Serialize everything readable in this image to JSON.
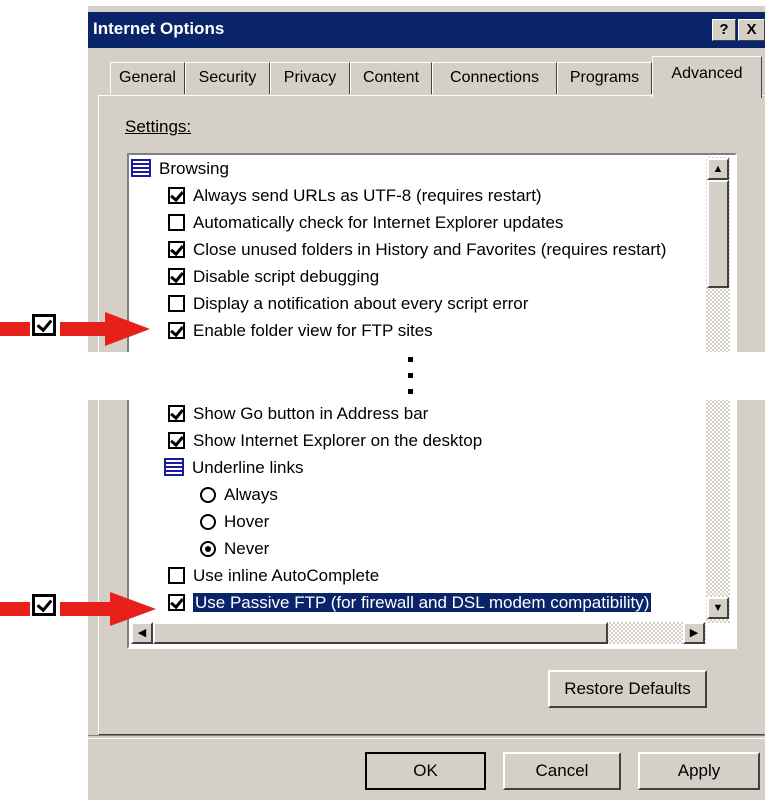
{
  "window": {
    "title": "Internet Options",
    "help_label": "?",
    "close_label": "X"
  },
  "tabs": [
    {
      "label": "General"
    },
    {
      "label": "Security"
    },
    {
      "label": "Privacy"
    },
    {
      "label": "Content"
    },
    {
      "label": "Connections"
    },
    {
      "label": "Programs"
    },
    {
      "label": "Advanced",
      "active": true
    }
  ],
  "settings_label": "Settings:",
  "settings_top": [
    {
      "type": "group",
      "label": "Browsing"
    },
    {
      "type": "checkbox",
      "checked": true,
      "label": "Always send URLs as UTF-8 (requires restart)"
    },
    {
      "type": "checkbox",
      "checked": false,
      "label": "Automatically check for Internet Explorer updates"
    },
    {
      "type": "checkbox",
      "checked": true,
      "label": "Close unused folders in History and Favorites (requires restart)"
    },
    {
      "type": "checkbox",
      "checked": true,
      "label": "Disable script debugging"
    },
    {
      "type": "checkbox",
      "checked": false,
      "label": "Display a notification about every script error"
    },
    {
      "type": "checkbox",
      "checked": true,
      "label": "Enable folder view for FTP sites"
    }
  ],
  "settings_bottom": [
    {
      "type": "checkbox",
      "checked": true,
      "label": "Show Go button in Address bar"
    },
    {
      "type": "checkbox",
      "checked": true,
      "label": "Show Internet Explorer on the desktop"
    },
    {
      "type": "group",
      "label": "Underline links"
    },
    {
      "type": "radio",
      "checked": false,
      "label": "Always"
    },
    {
      "type": "radio",
      "checked": false,
      "label": "Hover"
    },
    {
      "type": "radio",
      "checked": true,
      "label": "Never"
    },
    {
      "type": "checkbox",
      "checked": false,
      "label": "Use inline AutoComplete"
    },
    {
      "type": "checkbox",
      "checked": true,
      "selected": true,
      "label": "Use Passive FTP (for firewall and DSL modem compatibility)"
    }
  ],
  "buttons": {
    "restore_defaults": "Restore Defaults",
    "ok": "OK",
    "cancel": "Cancel",
    "apply": "Apply"
  },
  "colors": {
    "titlebar": "#0a246a",
    "dialog_face": "#d4d0c8",
    "arrow": "#e8201a",
    "selection": "#0a246a"
  },
  "icons": {
    "help": "help-icon",
    "close": "close-icon",
    "group": "settings-group-icon",
    "arrow": "red-arrow-icon"
  }
}
